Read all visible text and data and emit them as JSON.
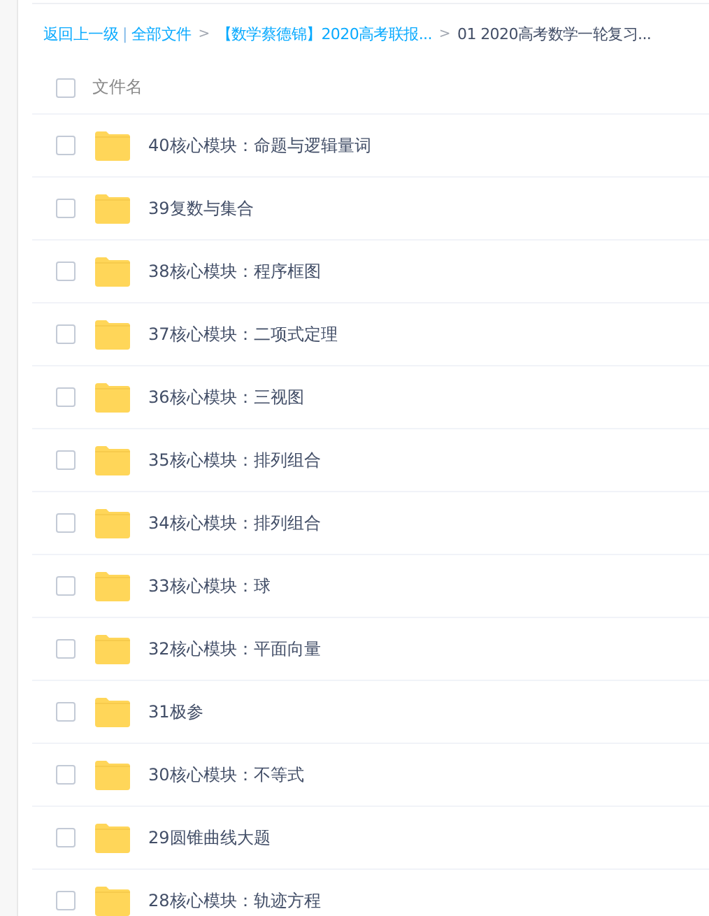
{
  "breadcrumb": {
    "back": "返回上一级",
    "divider": "|",
    "items": [
      {
        "label": "全部文件",
        "current": false
      },
      {
        "label": "【数学蔡德锦】2020高考联报...",
        "current": false
      },
      {
        "label": "01 2020高考数学一轮复习...",
        "current": true
      }
    ],
    "chevron": ">"
  },
  "header": {
    "checked": false,
    "label": "文件名"
  },
  "files": [
    {
      "name": "40核心模块：命题与逻辑量词",
      "checked": false
    },
    {
      "name": "39复数与集合",
      "checked": false
    },
    {
      "name": "38核心模块：程序框图",
      "checked": false
    },
    {
      "name": "37核心模块：二项式定理",
      "checked": false
    },
    {
      "name": "36核心模块：三视图",
      "checked": false
    },
    {
      "name": "35核心模块：排列组合",
      "checked": false
    },
    {
      "name": "34核心模块：排列组合",
      "checked": false
    },
    {
      "name": "33核心模块：球",
      "checked": false
    },
    {
      "name": "32核心模块：平面向量",
      "checked": false
    },
    {
      "name": "31极参",
      "checked": false
    },
    {
      "name": "30核心模块：不等式",
      "checked": false
    },
    {
      "name": "29圆锥曲线大题",
      "checked": false
    },
    {
      "name": "28核心模块：轨迹方程",
      "checked": false
    }
  ]
}
